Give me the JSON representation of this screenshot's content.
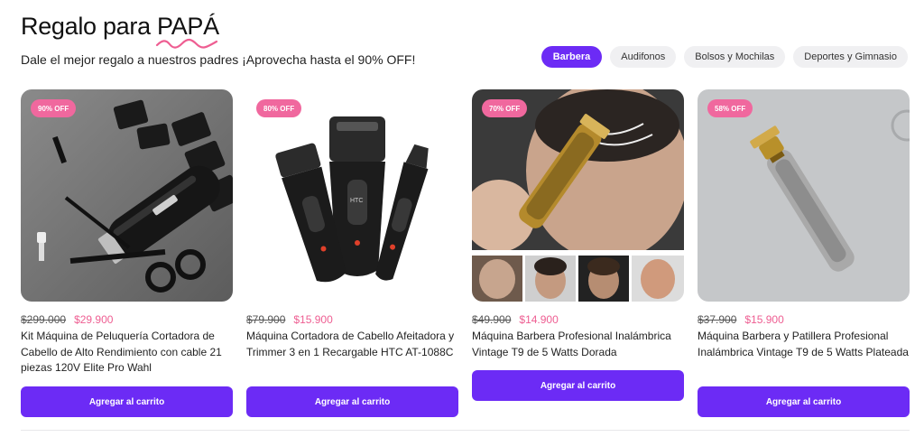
{
  "header": {
    "title_prefix": "Regalo para ",
    "title_highlight": "PAPÁ",
    "subtitle": "Dale el mejor regalo a nuestros padres ¡Aprovecha hasta el 90% OFF!"
  },
  "colors": {
    "accent": "#6c2bf5",
    "badge": "#f0689e",
    "sale_price": "#ee5e92"
  },
  "categories": [
    {
      "label": "Barbera",
      "active": true
    },
    {
      "label": "Audifonos",
      "active": false
    },
    {
      "label": "Bolsos y Mochilas",
      "active": false
    },
    {
      "label": "Deportes y Gimnasio",
      "active": false
    }
  ],
  "products": [
    {
      "badge": "90% OFF",
      "old_price": "$299.000",
      "price": "$29.900",
      "name": "Kit Máquina de Peluquería Cortadora de Cabello de Alto Rendimiento con cable 21 piezas 120V Elite Pro Wahl",
      "button": "Agregar al carrito"
    },
    {
      "badge": "80% OFF",
      "old_price": "$79.900",
      "price": "$15.900",
      "name": "Máquina Cortadora de Cabello Afeitadora y Trimmer 3 en 1 Recargable HTC AT-1088C",
      "button": "Agregar al carrito"
    },
    {
      "badge": "70% OFF",
      "old_price": "$49.900",
      "price": "$14.900",
      "name": "Máquina Barbera Profesional Inalámbrica Vintage T9 de 5 Watts Dorada",
      "button": "Agregar al carrito"
    },
    {
      "badge": "58% OFF",
      "old_price": "$37.900",
      "price": "$15.900",
      "name": "Máquina Barbera y Patillera Profesional Inalámbrica Vintage T9 de 5 Watts Plateada",
      "button": "Agregar al carrito"
    }
  ],
  "image_labels": {
    "htc_logo": "HTC"
  }
}
